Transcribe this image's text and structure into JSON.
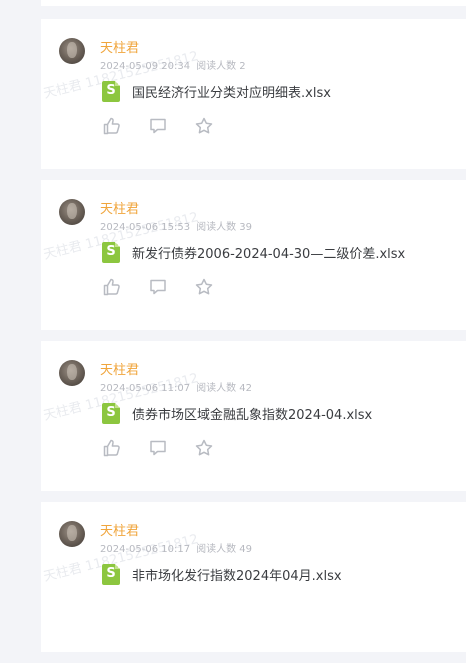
{
  "feed": {
    "posts": [
      {
        "author": "天柱君",
        "datetime": "2024-05-09 20:34",
        "reads": "阅读人数 2",
        "file_badge": "S",
        "file_name": "国民经济行业分类对应明细表.xlsx",
        "watermark": "天柱君 11821525251812"
      },
      {
        "author": "天柱君",
        "datetime": "2024-05-06 15:53",
        "reads": "阅读人数 39",
        "file_badge": "S",
        "file_name": "新发行债券2006-2024-04-30—二级价差.xlsx",
        "watermark": "天柱君 11821525251812"
      },
      {
        "author": "天柱君",
        "datetime": "2024-05-06 11:07",
        "reads": "阅读人数 42",
        "file_badge": "S",
        "file_name": "债券市场区域金融乱象指数2024-04.xlsx",
        "watermark": "天柱君 11821525251812"
      },
      {
        "author": "天柱君",
        "datetime": "2024-05-06 10:17",
        "reads": "阅读人数 49",
        "file_badge": "S",
        "file_name": "非市场化发行指数2024年04月.xlsx",
        "watermark": "天柱君 11821525251812"
      }
    ]
  },
  "icons": {
    "like": "thumbs-up-icon",
    "comment": "comment-icon",
    "favorite": "star-icon",
    "file": "spreadsheet-file-icon"
  },
  "colors": {
    "page_background": "#f3f4f8",
    "card_background": "#ffffff",
    "author": "#f0a53c",
    "meta": "#b7b9c0",
    "file_icon": "#8cc63f",
    "file_name": "#3a3c40",
    "action_icon": "#b8bbc2"
  }
}
